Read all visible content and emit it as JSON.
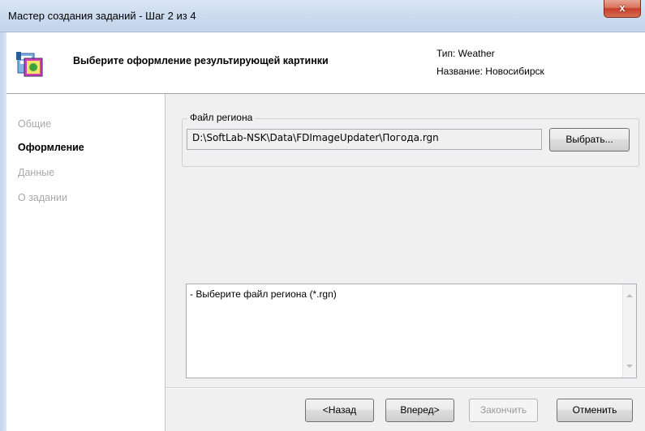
{
  "window": {
    "title": "Мастер создания заданий - Шаг 2 из 4",
    "close_glyph": "x"
  },
  "header": {
    "heading": "Выберите оформление результирующей картинки",
    "type_label": "Тип: Weather",
    "name_label": "Название: Новосибирск",
    "icon": "wizard-icon"
  },
  "sidebar": {
    "steps": [
      {
        "label": "Общие",
        "state": "done"
      },
      {
        "label": "Оформление",
        "state": "active"
      },
      {
        "label": "Данные",
        "state": "pending"
      },
      {
        "label": "О задании",
        "state": "pending"
      }
    ]
  },
  "region_group": {
    "legend": "Файл региона",
    "path_value": "D:\\SoftLab-NSK\\Data\\FDImageUpdater\\Погода.rgn",
    "browse_label": "Выбрать..."
  },
  "messages": {
    "text": "- Выберите файл региона (*.rgn)"
  },
  "buttons": {
    "back": "<Назад",
    "next": "Вперед>",
    "finish": "Закончить",
    "cancel": "Отменить"
  },
  "colors": {
    "title_bar": "#c3d4eb",
    "close_button": "#c7402a",
    "disabled_text": "#a8a8a8"
  }
}
